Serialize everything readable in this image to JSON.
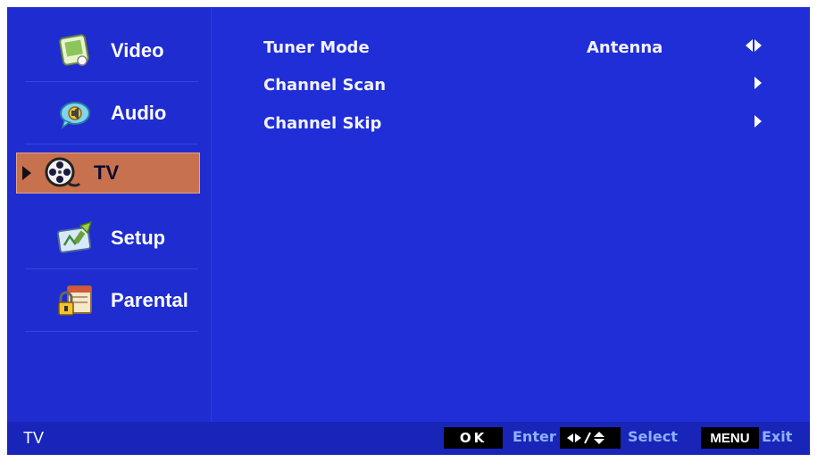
{
  "sidebar": {
    "items": [
      {
        "label": "Video",
        "icon": "video-icon"
      },
      {
        "label": "Audio",
        "icon": "audio-icon"
      },
      {
        "label": "TV",
        "icon": "tv-reel-icon",
        "selected": true
      },
      {
        "label": "Setup",
        "icon": "setup-icon"
      },
      {
        "label": "Parental",
        "icon": "parental-lock-icon"
      }
    ]
  },
  "main": {
    "rows": [
      {
        "label": "Tuner Mode",
        "value": "Antenna",
        "nav": "left-right-arrows-icon"
      },
      {
        "label": "Channel Scan",
        "value": "",
        "nav": "right-arrow-icon"
      },
      {
        "label": "Channel Skip",
        "value": "",
        "nav": "right-arrow-icon"
      }
    ]
  },
  "footer": {
    "title": "TV",
    "ok_key": "OK",
    "ok_action": "Enter",
    "select_action": "Select",
    "menu_key": "MENU",
    "menu_action": "Exit"
  },
  "colors": {
    "background": "#1f2ed6",
    "selected": "#c8714f",
    "footer": "#1825b8",
    "hint": "#8fb0ff"
  }
}
